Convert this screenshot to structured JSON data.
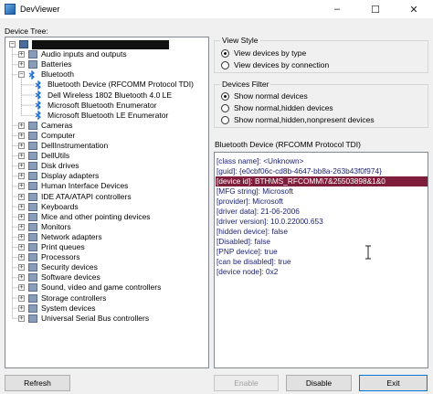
{
  "window": {
    "title": "DevViewer",
    "controls": [
      "–",
      "☐",
      "✕"
    ]
  },
  "tree_label": "Device Tree:",
  "tree_items": [
    {
      "label": "",
      "level": 0,
      "expander": "-",
      "icon": "root",
      "redacted": true
    },
    {
      "label": "Audio inputs and outputs",
      "level": 1,
      "expander": "+",
      "icon": "dev"
    },
    {
      "label": "Batteries",
      "level": 1,
      "expander": "+",
      "icon": "dev"
    },
    {
      "label": "Bluetooth",
      "level": 1,
      "expander": "-",
      "icon": "bt"
    },
    {
      "label": "Bluetooth Device (RFCOMM Protocol TDI)",
      "level": 2,
      "expander": "",
      "icon": "bt"
    },
    {
      "label": "Dell Wireless 1802 Bluetooth 4.0 LE",
      "level": 2,
      "expander": "",
      "icon": "bt"
    },
    {
      "label": "Microsoft Bluetooth Enumerator",
      "level": 2,
      "expander": "",
      "icon": "bt"
    },
    {
      "label": "Microsoft Bluetooth LE Enumerator",
      "level": 2,
      "expander": "",
      "icon": "bt"
    },
    {
      "label": "Cameras",
      "level": 1,
      "expander": "+",
      "icon": "dev"
    },
    {
      "label": "Computer",
      "level": 1,
      "expander": "+",
      "icon": "dev"
    },
    {
      "label": "DellInstrumentation",
      "level": 1,
      "expander": "+",
      "icon": "dev"
    },
    {
      "label": "DellUtils",
      "level": 1,
      "expander": "+",
      "icon": "dev"
    },
    {
      "label": "Disk drives",
      "level": 1,
      "expander": "+",
      "icon": "dev"
    },
    {
      "label": "Display adapters",
      "level": 1,
      "expander": "+",
      "icon": "dev"
    },
    {
      "label": "Human Interface Devices",
      "level": 1,
      "expander": "+",
      "icon": "dev"
    },
    {
      "label": "IDE ATA/ATAPI controllers",
      "level": 1,
      "expander": "+",
      "icon": "dev"
    },
    {
      "label": "Keyboards",
      "level": 1,
      "expander": "+",
      "icon": "dev"
    },
    {
      "label": "Mice and other pointing devices",
      "level": 1,
      "expander": "+",
      "icon": "dev"
    },
    {
      "label": "Monitors",
      "level": 1,
      "expander": "+",
      "icon": "dev"
    },
    {
      "label": "Network adapters",
      "level": 1,
      "expander": "+",
      "icon": "dev"
    },
    {
      "label": "Print queues",
      "level": 1,
      "expander": "+",
      "icon": "dev"
    },
    {
      "label": "Processors",
      "level": 1,
      "expander": "+",
      "icon": "dev"
    },
    {
      "label": "Security devices",
      "level": 1,
      "expander": "+",
      "icon": "dev"
    },
    {
      "label": "Software devices",
      "level": 1,
      "expander": "+",
      "icon": "dev"
    },
    {
      "label": "Sound, video and game controllers",
      "level": 1,
      "expander": "+",
      "icon": "dev"
    },
    {
      "label": "Storage controllers",
      "level": 1,
      "expander": "+",
      "icon": "dev"
    },
    {
      "label": "System devices",
      "level": 1,
      "expander": "+",
      "icon": "dev"
    },
    {
      "label": "Universal Serial Bus controllers",
      "level": 1,
      "expander": "+",
      "icon": "dev"
    }
  ],
  "view_style": {
    "title": "View Style",
    "options": [
      {
        "label": "View devices by type",
        "selected": true
      },
      {
        "label": "View devices by connection",
        "selected": false
      }
    ]
  },
  "devices_filter": {
    "title": "Devices Filter",
    "options": [
      {
        "label": "Show normal devices",
        "selected": true
      },
      {
        "label": "Show normal,hidden devices",
        "selected": false
      },
      {
        "label": "Show normal,hidden,nonpresent devices",
        "selected": false
      }
    ]
  },
  "details": {
    "title": "Bluetooth Device (RFCOMM Protocol TDI)",
    "lines": [
      {
        "text": "[class name]: <Unknown>",
        "highlighted": false
      },
      {
        "text": "[guid]: {e0cbf06c-cd8b-4647-bb8a-263b43f0f974}",
        "highlighted": false
      },
      {
        "text": "[device id]: BTH\\MS_RFCOMM\\7&25503898&1&0",
        "highlighted": true
      },
      {
        "text": "[MFG string]: Microsoft",
        "highlighted": false
      },
      {
        "text": "[provider]: Microsoft",
        "highlighted": false
      },
      {
        "text": "[driver data]: 21-06-2006",
        "highlighted": false
      },
      {
        "text": "[driver version]: 10.0.22000.653",
        "highlighted": false
      },
      {
        "text": "[hidden device]: false",
        "highlighted": false
      },
      {
        "text": "[Disabled]: false",
        "highlighted": false
      },
      {
        "text": "[PNP device]: true",
        "highlighted": false
      },
      {
        "text": "[can be disabled]: true",
        "highlighted": false
      },
      {
        "text": "[device node]: 0x2",
        "highlighted": false
      }
    ]
  },
  "buttons": {
    "refresh": "Refresh",
    "enable": "Enable",
    "disable": "Disable",
    "exit": "Exit"
  },
  "colors": {
    "highlight": "#7e1e3a",
    "detail_text": "#1a1f6e",
    "focus": "#0078d7"
  }
}
